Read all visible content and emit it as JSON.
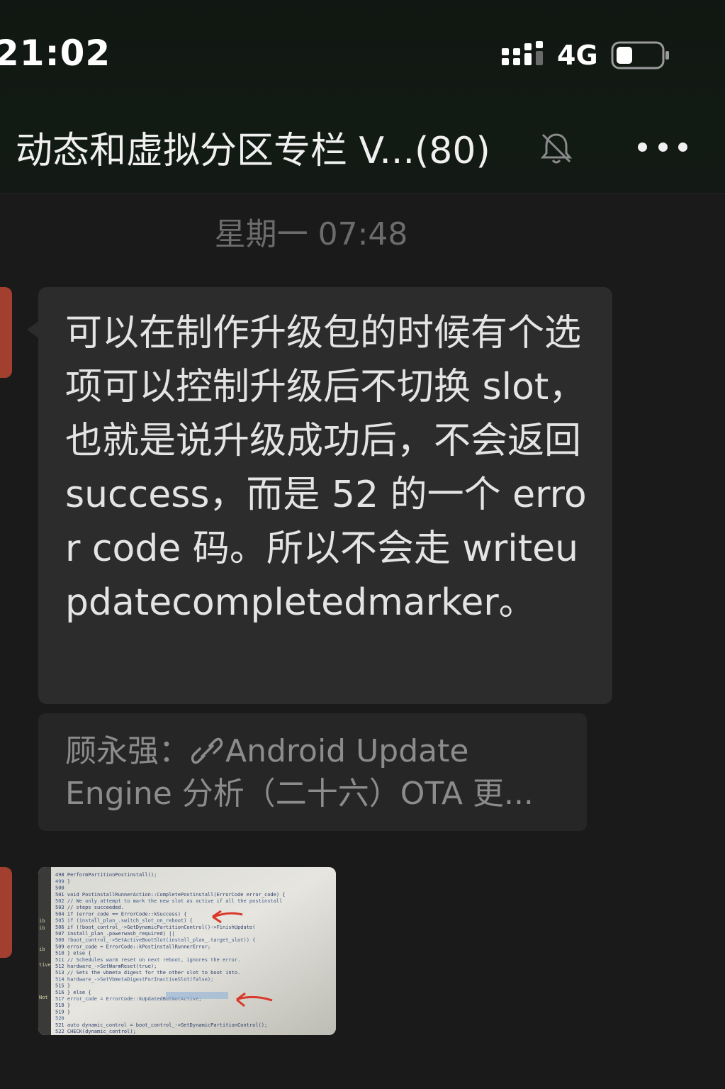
{
  "status_bar": {
    "time": "21:02",
    "network": "4G",
    "signal_icon": "signal-bars-icon",
    "battery_icon": "battery-icon"
  },
  "header": {
    "title": "动态和虚拟分区专栏 V...(80)",
    "mute_icon": "bell-muted-icon",
    "more_icon": "more-dots-icon"
  },
  "messages": {
    "timestamp": "星期一 07:48",
    "text": "可以在制作升级包的时候有个选项可以控制升级后不切换 slot，也就是说升级成功后，不会返回 success，而是 52 的一个 error code 码。所以不会走 writeupdatecompletedmarker。",
    "quote": {
      "prefix": "顾永强：",
      "link_icon": "link-icon",
      "line1": "Android Update",
      "line2": "Engine 分析（二十六）OTA 更..."
    },
    "image": {
      "description_icon": "code-screenshot-image",
      "code_lines": [
        "498        PerformPartitionPostinstall();",
        "499    }",
        "500",
        "501 void PostinstallRunnerAction::CompletePostinstall(ErrorCode error_code) {",
        "502   // We only attempt to mark the new slot as active if all the postinstall",
        "503   // steps succeeded.",
        "504   if (error_code == ErrorCode::kSuccess) {",
        "505     if (install_plan_.switch_slot_on_reboot) {",
        "506       if (!boot_control_->GetDynamicPartitionControl()->FinishUpdate(",
        "507               install_plan_.powerwash_required) ||",
        "508           !boot_control_->SetActiveBootSlot(install_plan_.target_slot)) {",
        "509         error_code = ErrorCode::kPostinstallRunnerError;",
        "510       } else {",
        "511         // Schedules warm reset on next reboot, ignores the error.",
        "512         hardware_->SetWarmReset(true);",
        "513         // Sets the vbmeta digest for the other slot to boot into.",
        "514         hardware_->SetVbmetaDigestForInactiveSlot(false);",
        "515       }",
        "516     } else {",
        "517       error_code = ErrorCode::kUpdatedButNotActive;",
        "518     }",
        "519   }",
        "520",
        "521   auto dynamic_control = boot_control_->GetDynamicPartitionControl();",
        "522   CHECK(dynamic_control);"
      ],
      "side_labels": [
        "ib",
        "ib",
        "ib",
        "tive",
        "Not"
      ]
    }
  }
}
